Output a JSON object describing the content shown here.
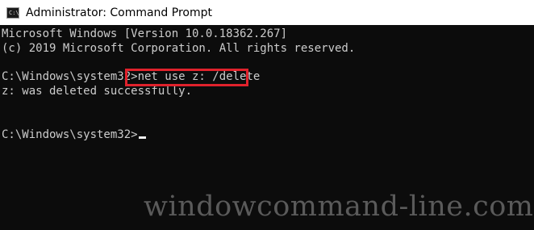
{
  "window": {
    "title": "Administrator: Command Prompt",
    "icon": "cmd-icon"
  },
  "console": {
    "lines": [
      "Microsoft Windows [Version 10.0.18362.267]",
      "(c) 2019 Microsoft Corporation. All rights reserved.",
      "",
      "C:\\Windows\\system32>net use z: /delete",
      "z: was deleted successfully.",
      "",
      "",
      "C:\\Windows\\system32>"
    ],
    "prompt": "C:\\Windows\\system32>",
    "command": "net use z: /delete",
    "highlighted_command": "net use z: /delete",
    "highlight_color": "#e0222c"
  },
  "watermark": {
    "text": "windowcommand-line.com"
  },
  "colors": {
    "console_background": "#0c0c0c",
    "console_text": "#cccccc",
    "titlebar_background": "#ffffff"
  }
}
